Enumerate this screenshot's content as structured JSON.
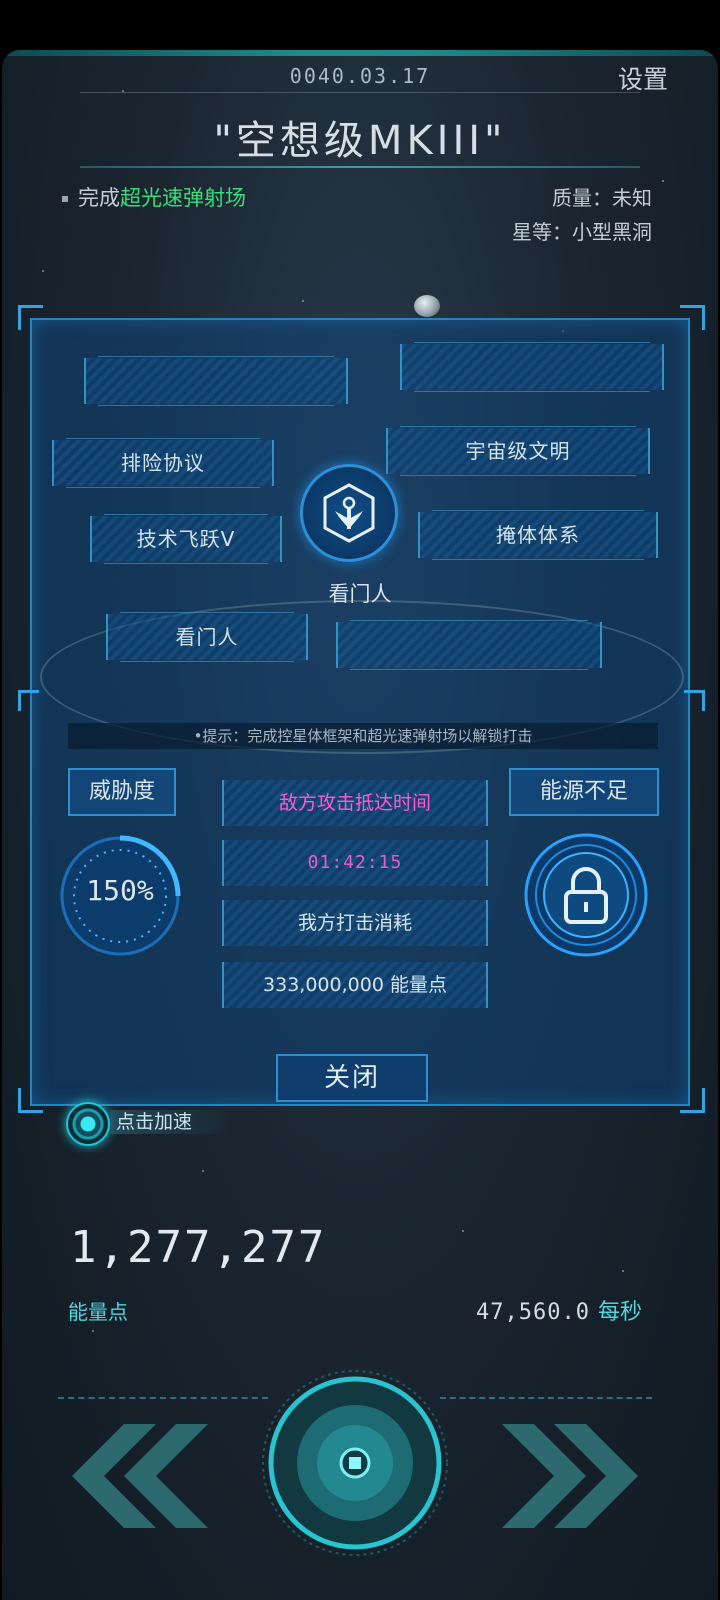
{
  "header": {
    "date": "0040.03.17",
    "settings_label": "设置",
    "title": "\"空想级MKIII\""
  },
  "objective": {
    "prefix": "完成",
    "highlight": "超光速弹射场"
  },
  "stats": {
    "mass": "质量：未知",
    "rank": "星等：小型黑洞"
  },
  "tech_tree": {
    "slots": [
      "",
      "",
      "排险协议",
      "宇宙级文明",
      "技术飞跃V",
      "掩体体系",
      "看门人",
      ""
    ],
    "center_label": "看门人"
  },
  "strike_panel": {
    "hint": "•提示：完成控星体框架和超光速弹射场以解锁打击",
    "threat_label": "威胁度",
    "threat_value": "150%",
    "energy_status": "能源不足",
    "enemy_time_label": "敌方攻击抵达时间",
    "enemy_time_value": "01:42:15",
    "our_cost_label": "我方打击消耗",
    "our_cost_value": "333,000,000 能量点",
    "close_label": "关闭"
  },
  "accelerate": {
    "label": "点击加速"
  },
  "energy": {
    "total": "1,277,277",
    "unit": "能量点",
    "rate": "47,560.0",
    "rate_unit": "每秒"
  },
  "colors": {
    "accent_cyan": "#52d6e0",
    "highlight_green": "#35e07b",
    "warning_pink": "#ff5bd0",
    "panel_border": "#1e86c4"
  },
  "icons": {
    "emblem": "gatekeeper-emblem-icon",
    "lock": "lock-icon",
    "accelerate": "pulse-ring-icon",
    "left": "double-chevron-left-icon",
    "right": "double-chevron-right-icon",
    "center": "core-button-icon"
  }
}
